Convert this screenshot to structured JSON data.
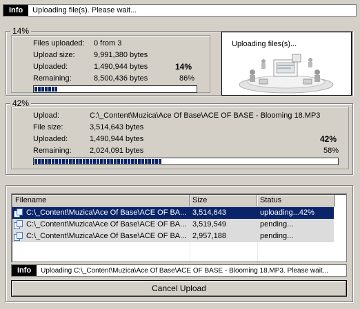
{
  "top_info": {
    "tag": "Info",
    "text": "Uploading file(s). Please wait..."
  },
  "overall": {
    "title": "14%",
    "files_uploaded_label": "Files uploaded:",
    "files_uploaded_value": "0 from 3",
    "upload_size_label": "Upload size:",
    "upload_size_value": "9,991,380 bytes",
    "uploaded_label": "Uploaded:",
    "uploaded_value": "1,490,944 bytes",
    "uploaded_pct": "14%",
    "remaining_label": "Remaining:",
    "remaining_value": "8,500,436 bytes",
    "remaining_pct": "86%",
    "progress_fraction": 0.14
  },
  "image_panel": {
    "caption": "Uploading files(s)..."
  },
  "current": {
    "title": "42%",
    "upload_label": "Upload:",
    "upload_value": "C:\\_Content\\Muzica\\Ace Of Base\\ACE OF BASE - Blooming 18.MP3",
    "file_size_label": "File size:",
    "file_size_value": "3,514,643 bytes",
    "uploaded_label": "Uploaded:",
    "uploaded_value": "1,490,944 bytes",
    "uploaded_pct": "42%",
    "remaining_label": "Remaining:",
    "remaining_value": "2,024,091 bytes",
    "remaining_pct": "58%",
    "progress_fraction": 0.42
  },
  "list": {
    "columns": [
      "Filename",
      "Size",
      "Status"
    ],
    "rows": [
      {
        "filename": "C:\\_Content\\Muzica\\Ace Of Base\\ACE OF BA...",
        "size": "3,514,643",
        "status": "uploading...42%"
      },
      {
        "filename": "C:\\_Content\\Muzica\\Ace Of Base\\ACE OF BA...",
        "size": "3,519,549",
        "status": "pending..."
      },
      {
        "filename": "C:\\_Content\\Muzica\\Ace Of Base\\ACE OF BA...",
        "size": "2,957,188",
        "status": "pending..."
      }
    ]
  },
  "bottom_info": {
    "tag": "Info",
    "text": "Uploading C:\\_Content\\Muzica\\Ace Of Base\\ACE OF BASE - Blooming 18.MP3. Please wait..."
  },
  "cancel_label": "Cancel Upload",
  "colors": {
    "selection": "#0a246a",
    "face": "#d4d0c8",
    "progress": "#0a246a"
  }
}
